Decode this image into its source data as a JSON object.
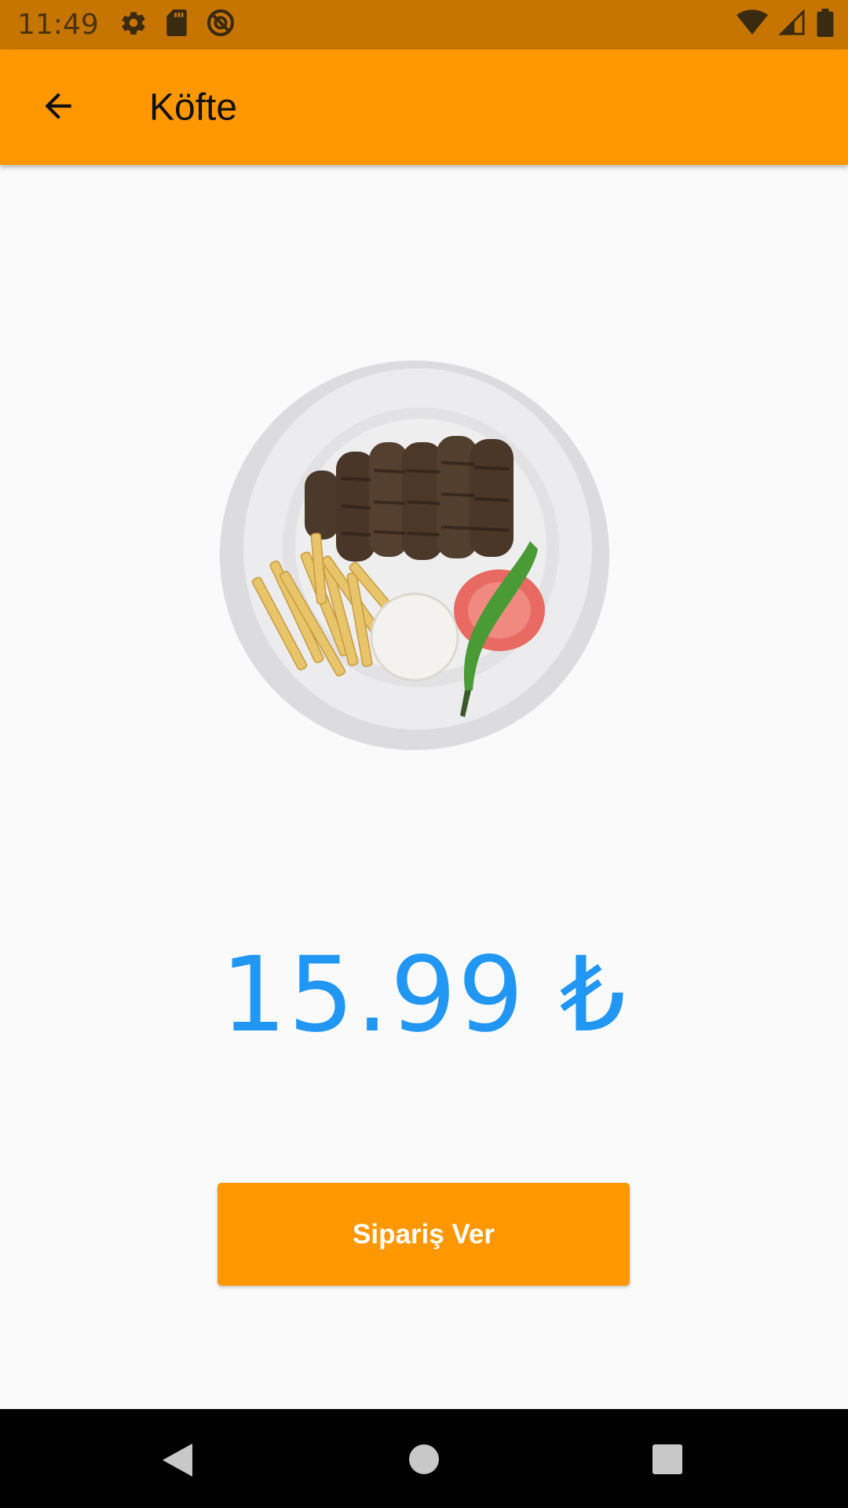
{
  "status_bar": {
    "time": "11:49",
    "left_icons": [
      "gear-icon",
      "sd-card-icon",
      "no-entry-icon"
    ],
    "right_icons": [
      "wifi-icon",
      "cell-signal-icon",
      "battery-icon"
    ]
  },
  "app_bar": {
    "title": "Köfte",
    "back_icon": "arrow-left-icon"
  },
  "product": {
    "image": "kofte-plate-photo",
    "price": "15.99 ₺"
  },
  "actions": {
    "order_label": "Sipariş Ver"
  },
  "nav_bar": {
    "buttons": [
      "nav-back-icon",
      "nav-home-icon",
      "nav-recents-icon"
    ]
  },
  "colors": {
    "status_bar": "#c67600",
    "app_bar": "#ff9800",
    "price_text": "#2196f3",
    "button": "#ff9800",
    "background": "#fafafa"
  }
}
